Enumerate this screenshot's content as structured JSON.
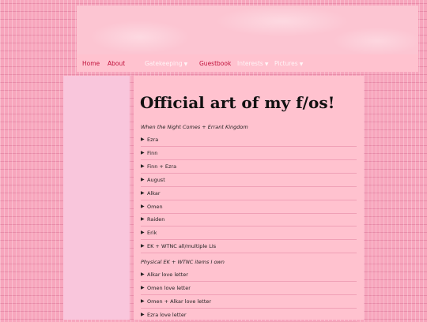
{
  "nav": {
    "items": [
      {
        "label": "Home",
        "caret": false
      },
      {
        "label": "About",
        "caret": false
      },
      {
        "label": "Gatekeeping",
        "caret": true
      },
      {
        "label": "Guestbook",
        "caret": false
      },
      {
        "label": "Interests",
        "caret": true
      },
      {
        "label": "Pictures",
        "caret": true
      }
    ]
  },
  "main": {
    "title": "Official art of my f/os!",
    "sections": [
      {
        "heading": "When the Night Comes + Errant Kingdom",
        "items": [
          "Ezra",
          "Finn",
          "Finn + Ezra",
          "August",
          "Alkar",
          "Omen",
          "Raiden",
          "Erik",
          "EK + WTNC all/multiple LIs"
        ]
      },
      {
        "heading": "Physical EK + WTNC items I own",
        "items": [
          "Alkar love letter",
          "Omen love letter",
          "Omen + Alkar love letter",
          "Ezra love letter"
        ]
      }
    ]
  },
  "icons": {
    "disclosure": "triangle-right-icon",
    "dropdown": "caret-down-icon"
  },
  "colors": {
    "accent": "#c0103a",
    "background": "#f7a6bd",
    "panel": "#ffc2cf",
    "sidebar": "#f9c6dc"
  }
}
